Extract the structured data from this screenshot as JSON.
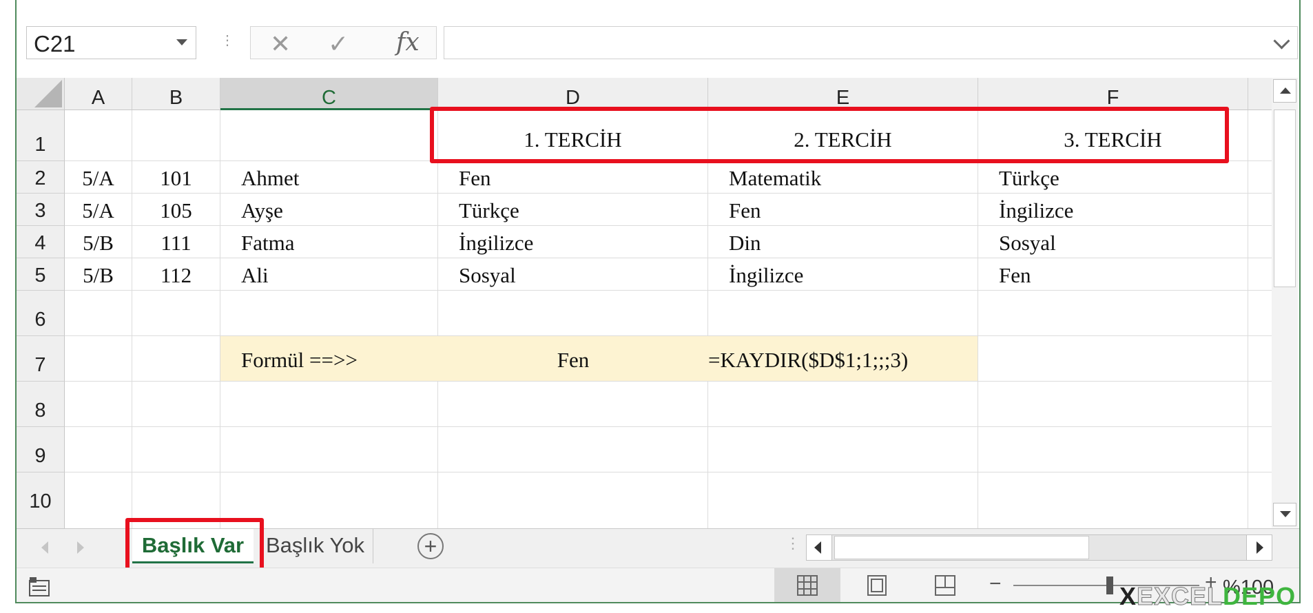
{
  "formula_bar": {
    "name_box": "C21",
    "cancel_icon": "close-icon",
    "enter_icon": "check-icon",
    "function_label": "fx",
    "formula_value": ""
  },
  "columns": [
    "A",
    "B",
    "C",
    "D",
    "E",
    "F"
  ],
  "selected_column": "C",
  "rows": [
    "1",
    "2",
    "3",
    "4",
    "5",
    "6",
    "7",
    "8",
    "9",
    "10"
  ],
  "cells": {
    "D1": "1. TERCİH",
    "E1": "2. TERCİH",
    "F1": "3. TERCİH",
    "A2": "5/A",
    "B2": "101",
    "C2": "Ahmet",
    "D2": "Fen",
    "E2": "Matematik",
    "F2": "Türkçe",
    "A3": "5/A",
    "B3": "105",
    "C3": "Ayşe",
    "D3": "Türkçe",
    "E3": "Fen",
    "F3": "İngilizce",
    "A4": "5/B",
    "B4": "111",
    "C4": "Fatma",
    "D4": "İngilizce",
    "E4": "Din",
    "F4": "Sosyal",
    "A5": "5/B",
    "B5": "112",
    "C5": "Ali",
    "D5": "Sosyal",
    "E5": "İngilizce",
    "F5": "Fen",
    "C7": "Formül ==>>",
    "D7": "Fen",
    "E7": "=KAYDIR($D$1;1;;;3)"
  },
  "highlight_color": "#fdf3d2",
  "annotation_color": "#e8101e",
  "sheet_tabs": [
    {
      "label": "Başlık Var",
      "active": true
    },
    {
      "label": "Başlık Yok",
      "active": false
    }
  ],
  "add_sheet_icon": "plus-circle-icon",
  "status_bar": {
    "macro_icon": "record-macro-icon",
    "views": [
      "normal-view-icon",
      "page-layout-icon",
      "page-break-icon"
    ],
    "zoom_minus": "−",
    "zoom_plus": "+",
    "zoom_level": "%100"
  },
  "watermark": {
    "part1": "X",
    "part2": "EXCEL",
    "part3": "DEPO"
  },
  "accent_color": "#217346"
}
